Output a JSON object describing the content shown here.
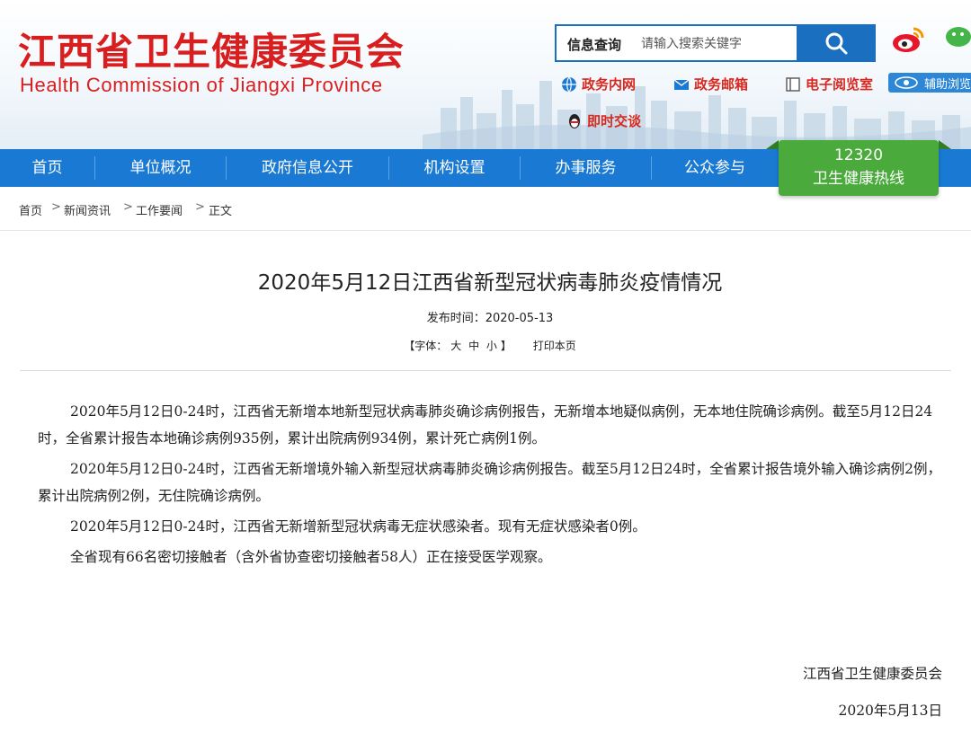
{
  "header": {
    "logo_cn": "江西省卫生健康委员会",
    "logo_en": "Health Commission of Jiangxi Province",
    "search": {
      "label": "信息查询",
      "placeholder": "请输入搜索关键字"
    },
    "quicklinks": [
      "政务内网",
      "政务邮箱",
      "电子阅览室",
      "即时交谈"
    ],
    "assist_label": "辅助浏览",
    "social": [
      "weibo-icon",
      "wechat-icon"
    ]
  },
  "nav": {
    "items": [
      "首页",
      "单位概况",
      "政府信息公开",
      "机构设置",
      "办事服务",
      "公众参与"
    ],
    "hotline": {
      "number": "12320",
      "label": "卫生健康热线"
    }
  },
  "breadcrumb": [
    "首页",
    "新闻资讯",
    "工作要闻",
    "正文"
  ],
  "article": {
    "title": "2020年5月12日江西省新型冠状病毒肺炎疫情情况",
    "pubdate": "发布时间：2020-05-13",
    "font_label": "【字体：",
    "font_large": "大",
    "font_medium": "中",
    "font_small": "小",
    "font_end": "】",
    "print": "打印本页",
    "paragraphs": [
      "2020年5月12日0-24时，江西省无新增本地新型冠状病毒肺炎确诊病例报告，无新增本地疑似病例，无本地住院确诊病例。截至5月12日24时，全省累计报告本地确诊病例935例，累计出院病例934例，累计死亡病例1例。",
      "2020年5月12日0-24时，江西省无新增境外输入新型冠状病毒肺炎确诊病例报告。截至5月12日24时，全省累计报告境外输入确诊病例2例，累计出院病例2例，无住院确诊病例。",
      "2020年5月12日0-24时，江西省无新增新型冠状病毒无症状感染者。现有无症状感染者0例。",
      "全省现有66名密切接触者（含外省协查密切接触者58人）正在接受医学观察。"
    ],
    "signature": "江西省卫生健康委员会",
    "sign_date": "2020年5月13日"
  },
  "colors": {
    "brand_red": "#d81e1e",
    "nav_blue": "#1a7ad3",
    "hotline_green": "#4aab3c"
  }
}
